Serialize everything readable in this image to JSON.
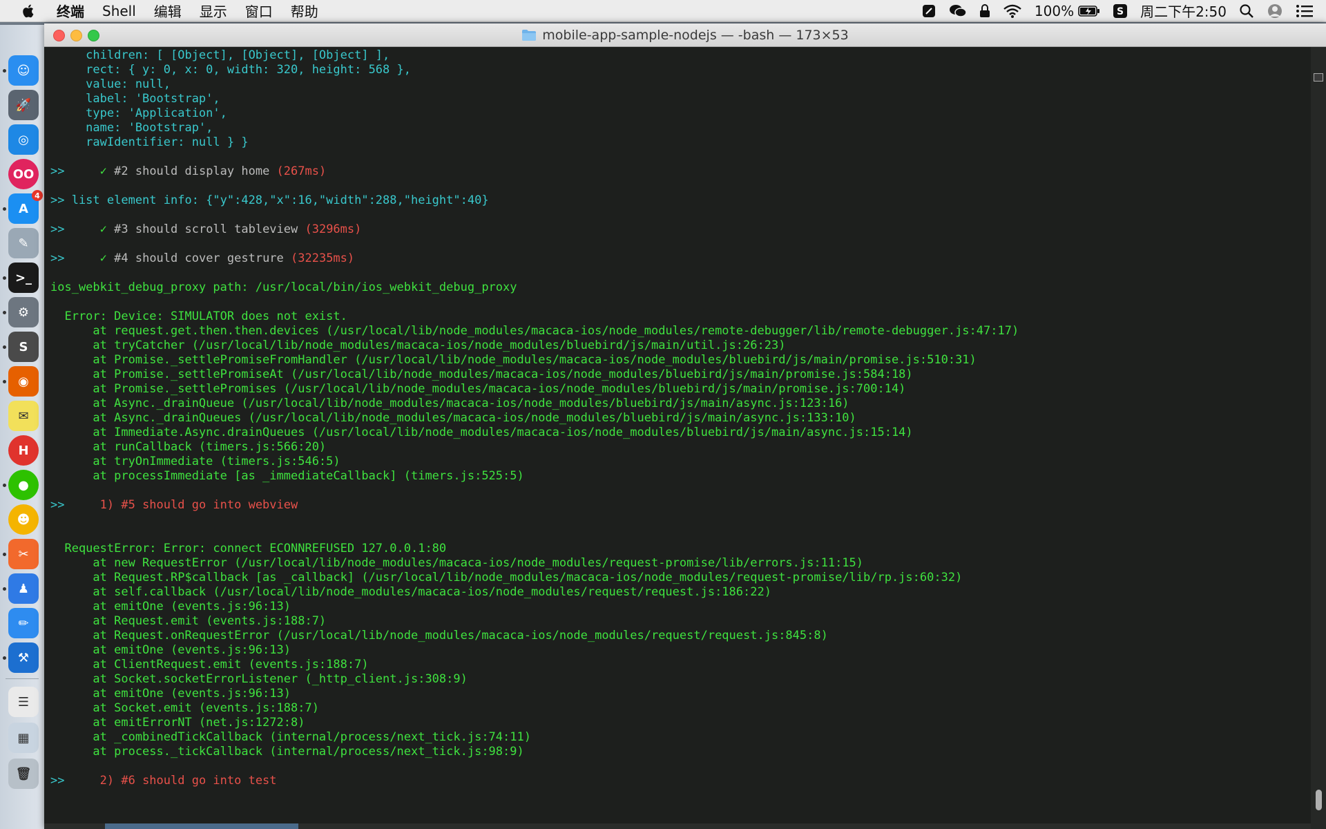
{
  "menubar": {
    "app_name": "终端",
    "items": [
      "Shell",
      "编辑",
      "显示",
      "窗口",
      "帮助"
    ],
    "battery": "100%",
    "clock": "周二下午2:50"
  },
  "dock": {
    "apps": [
      {
        "name": "finder",
        "color": "#2a8ef0",
        "label": "☺"
      },
      {
        "name": "launchpad",
        "color": "#5a6470",
        "label": "🚀"
      },
      {
        "name": "safari",
        "color": "#1e88e5",
        "label": "◎"
      },
      {
        "name": "flickr",
        "color": "#e0245e",
        "label": "OO"
      },
      {
        "name": "app-store",
        "color": "#1b8ff2",
        "label": "A",
        "badge": "4"
      },
      {
        "name": "script-editor",
        "color": "#9aa8b5",
        "label": "✎"
      },
      {
        "name": "terminal",
        "color": "#1a1a1a",
        "label": ">_"
      },
      {
        "name": "system-preferences",
        "color": "#6d7680",
        "label": "⚙"
      },
      {
        "name": "sublime-text",
        "color": "#4a4a4a",
        "label": "S"
      },
      {
        "name": "firefox",
        "color": "#e66000",
        "label": "◉"
      },
      {
        "name": "stickies",
        "color": "#f2e05a",
        "label": "✉"
      },
      {
        "name": "h-app",
        "color": "#e0332d",
        "label": "H"
      },
      {
        "name": "wechat",
        "color": "#2dc100",
        "label": "●"
      },
      {
        "name": "emoji-app",
        "color": "#f4b400",
        "label": "☻"
      },
      {
        "name": "instruments",
        "color": "#f2692c",
        "label": "✂"
      },
      {
        "name": "contacts",
        "color": "#2f7ae5",
        "label": "♟"
      },
      {
        "name": "pencil-app",
        "color": "#2e8cf0",
        "label": "✏"
      },
      {
        "name": "xcode",
        "color": "#1c6fd0",
        "label": "⚒"
      },
      {
        "name": "document",
        "color": "#eaeaea",
        "label": "☰"
      },
      {
        "name": "downloads",
        "color": "#c8d4e0",
        "label": "▦"
      },
      {
        "name": "trash",
        "color": "#b7c0c8",
        "label": "🗑"
      }
    ]
  },
  "window": {
    "title": "mobile-app-sample-nodejs — -bash — 173×53"
  },
  "terminal": {
    "lines": [
      [
        {
          "t": "     children: [ [Object], [Object], [Object] ],",
          "c": "cyan"
        }
      ],
      [
        {
          "t": "     rect: { y: 0, x: 0, width: 320, height: 568 },",
          "c": "cyan"
        }
      ],
      [
        {
          "t": "     value: null,",
          "c": "cyan"
        }
      ],
      [
        {
          "t": "     label: 'Bootstrap',",
          "c": "cyan"
        }
      ],
      [
        {
          "t": "     type: 'Application',",
          "c": "cyan"
        }
      ],
      [
        {
          "t": "     name: 'Bootstrap',",
          "c": "cyan"
        }
      ],
      [
        {
          "t": "     rawIdentifier: null } }",
          "c": "cyan"
        }
      ],
      [],
      [
        {
          "t": ">>     ",
          "c": "cyan"
        },
        {
          "t": "✓ ",
          "c": "check"
        },
        {
          "t": "#2 should display home ",
          "c": "gray"
        },
        {
          "t": "(267ms)",
          "c": "red"
        }
      ],
      [],
      [
        {
          "t": ">> list element info: {\"y\":428,\"x\":16,\"width\":288,\"height\":40}",
          "c": "cyan"
        }
      ],
      [],
      [
        {
          "t": ">>     ",
          "c": "cyan"
        },
        {
          "t": "✓ ",
          "c": "check"
        },
        {
          "t": "#3 should scroll tableview ",
          "c": "gray"
        },
        {
          "t": "(3296ms)",
          "c": "red"
        }
      ],
      [],
      [
        {
          "t": ">>     ",
          "c": "cyan"
        },
        {
          "t": "✓ ",
          "c": "check"
        },
        {
          "t": "#4 should cover gestrure ",
          "c": "gray"
        },
        {
          "t": "(32235ms)",
          "c": "red"
        }
      ],
      [],
      [
        {
          "t": "ios_webkit_debug_proxy path: /usr/local/bin/ios_webkit_debug_proxy",
          "c": "green"
        }
      ],
      [],
      [
        {
          "t": "  Error: Device: SIMULATOR does not exist.",
          "c": "green"
        }
      ],
      [
        {
          "t": "      at request.get.then.then.devices (/usr/local/lib/node_modules/macaca-ios/node_modules/remote-debugger/lib/remote-debugger.js:47:17)",
          "c": "green"
        }
      ],
      [
        {
          "t": "      at tryCatcher (/usr/local/lib/node_modules/macaca-ios/node_modules/bluebird/js/main/util.js:26:23)",
          "c": "green"
        }
      ],
      [
        {
          "t": "      at Promise._settlePromiseFromHandler (/usr/local/lib/node_modules/macaca-ios/node_modules/bluebird/js/main/promise.js:510:31)",
          "c": "green"
        }
      ],
      [
        {
          "t": "      at Promise._settlePromiseAt (/usr/local/lib/node_modules/macaca-ios/node_modules/bluebird/js/main/promise.js:584:18)",
          "c": "green"
        }
      ],
      [
        {
          "t": "      at Promise._settlePromises (/usr/local/lib/node_modules/macaca-ios/node_modules/bluebird/js/main/promise.js:700:14)",
          "c": "green"
        }
      ],
      [
        {
          "t": "      at Async._drainQueue (/usr/local/lib/node_modules/macaca-ios/node_modules/bluebird/js/main/async.js:123:16)",
          "c": "green"
        }
      ],
      [
        {
          "t": "      at Async._drainQueues (/usr/local/lib/node_modules/macaca-ios/node_modules/bluebird/js/main/async.js:133:10)",
          "c": "green"
        }
      ],
      [
        {
          "t": "      at Immediate.Async.drainQueues (/usr/local/lib/node_modules/macaca-ios/node_modules/bluebird/js/main/async.js:15:14)",
          "c": "green"
        }
      ],
      [
        {
          "t": "      at runCallback (timers.js:566:20)",
          "c": "green"
        }
      ],
      [
        {
          "t": "      at tryOnImmediate (timers.js:546:5)",
          "c": "green"
        }
      ],
      [
        {
          "t": "      at processImmediate [as _immediateCallback] (timers.js:525:5)",
          "c": "green"
        }
      ],
      [],
      [
        {
          "t": ">>     ",
          "c": "cyan"
        },
        {
          "t": "1) #5 should go into webview",
          "c": "red"
        }
      ],
      [],
      [],
      [
        {
          "t": "  RequestError: Error: connect ECONNREFUSED 127.0.0.1:80",
          "c": "green"
        }
      ],
      [
        {
          "t": "      at new RequestError (/usr/local/lib/node_modules/macaca-ios/node_modules/request-promise/lib/errors.js:11:15)",
          "c": "green"
        }
      ],
      [
        {
          "t": "      at Request.RP$callback [as _callback] (/usr/local/lib/node_modules/macaca-ios/node_modules/request-promise/lib/rp.js:60:32)",
          "c": "green"
        }
      ],
      [
        {
          "t": "      at self.callback (/usr/local/lib/node_modules/macaca-ios/node_modules/request/request.js:186:22)",
          "c": "green"
        }
      ],
      [
        {
          "t": "      at emitOne (events.js:96:13)",
          "c": "green"
        }
      ],
      [
        {
          "t": "      at Request.emit (events.js:188:7)",
          "c": "green"
        }
      ],
      [
        {
          "t": "      at Request.onRequestError (/usr/local/lib/node_modules/macaca-ios/node_modules/request/request.js:845:8)",
          "c": "green"
        }
      ],
      [
        {
          "t": "      at emitOne (events.js:96:13)",
          "c": "green"
        }
      ],
      [
        {
          "t": "      at ClientRequest.emit (events.js:188:7)",
          "c": "green"
        }
      ],
      [
        {
          "t": "      at Socket.socketErrorListener (_http_client.js:308:9)",
          "c": "green"
        }
      ],
      [
        {
          "t": "      at emitOne (events.js:96:13)",
          "c": "green"
        }
      ],
      [
        {
          "t": "      at Socket.emit (events.js:188:7)",
          "c": "green"
        }
      ],
      [
        {
          "t": "      at emitErrorNT (net.js:1272:8)",
          "c": "green"
        }
      ],
      [
        {
          "t": "      at _combinedTickCallback (internal/process/next_tick.js:74:11)",
          "c": "green"
        }
      ],
      [
        {
          "t": "      at process._tickCallback (internal/process/next_tick.js:98:9)",
          "c": "green"
        }
      ],
      [],
      [
        {
          "t": ">>     ",
          "c": "cyan"
        },
        {
          "t": "2) #6 should go into test",
          "c": "red"
        }
      ]
    ]
  }
}
